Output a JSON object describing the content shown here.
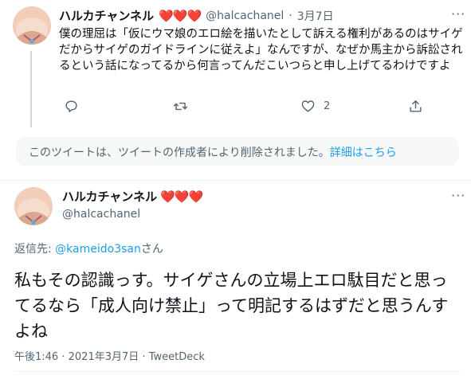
{
  "tweet1": {
    "display_name": "ハルカチャンネル",
    "hearts": "❤️❤️❤️",
    "handle": "@halcachanel",
    "separator": "·",
    "date": "3月7日",
    "text": "僕の理屈は「仮にウマ娘のエロ絵を描いたとして訴える権利があるのはサイゲだからサイゲのガイドラインに従えよ」なんですが、なぜか馬主から訴訟されるという話になってるから何言ってんだこいつらと申し上げてるわけですよ",
    "actions": {
      "reply_icon": "reply-icon",
      "retweet_icon": "retweet-icon",
      "like_icon": "heart-icon",
      "like_count": "2",
      "share_icon": "share-icon"
    }
  },
  "deleted_notice": {
    "text": "このツイートは、ツイートの作成者により削除されました。",
    "link": "詳細はこちら"
  },
  "tweet2": {
    "display_name": "ハルカチャンネル",
    "hearts": "❤️❤️❤️",
    "handle": "@halcachanel",
    "reply_prefix": "返信先: ",
    "reply_to": "@kameido3san",
    "reply_suffix": "さん",
    "text": "私もその認識っす。サイゲさんの立場上エロ駄目だと思ってるなら「成人向け禁止」って明記するはずだと思うんすよね",
    "time": "午後1:46",
    "date": "2021年3月7日",
    "source": "TweetDeck",
    "meta_separator": "·"
  },
  "colors": {
    "accent": "#1d9bf0",
    "hearts": "#e0245e",
    "muted": "#536471",
    "notice_bg": "#f7f9f9"
  }
}
